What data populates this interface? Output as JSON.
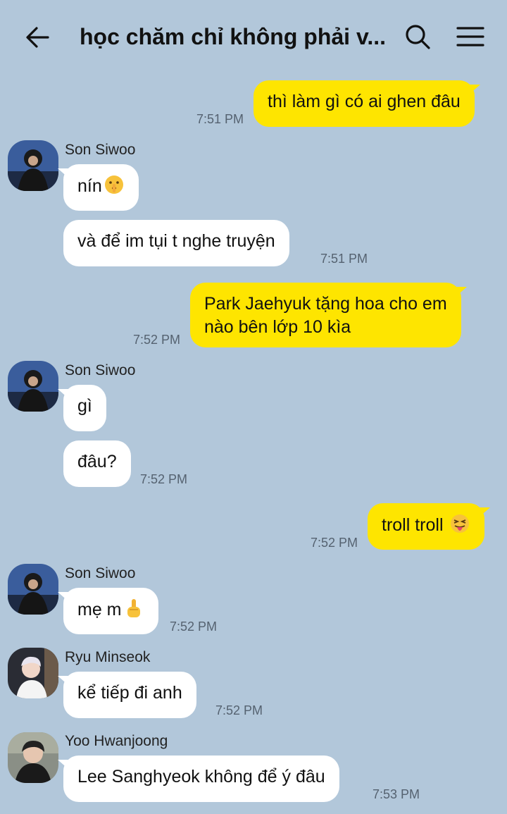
{
  "header": {
    "title": "học chăm chỉ không phải v...",
    "back_icon": "arrow-left-icon",
    "search_icon": "search-icon",
    "menu_icon": "hamburger-menu-icon"
  },
  "colors": {
    "background": "#b2c7da",
    "my_bubble": "#fee500",
    "their_bubble": "#ffffff"
  },
  "messages": [
    {
      "from": "me",
      "text": "thì làm gì có ai ghen đâu",
      "time": "7:51 PM"
    },
    {
      "from": "Son Siwoo",
      "sender": "Son Siwoo",
      "text": "nín",
      "emoji": "shushing-face-emoji"
    },
    {
      "from": "Son Siwoo",
      "text": "và để im tụi t nghe truyện",
      "time": "7:51 PM"
    },
    {
      "from": "me",
      "line1": "Park Jaehyuk tặng hoa cho em",
      "line2": "nào bên lớp 10 kìa",
      "time": "7:52 PM"
    },
    {
      "from": "Son Siwoo",
      "sender": "Son Siwoo",
      "text": "gì"
    },
    {
      "from": "Son Siwoo",
      "text": "đâu?",
      "time": "7:52 PM"
    },
    {
      "from": "me",
      "text": "troll troll",
      "emoji": "tongue-out-face-emoji",
      "time": "7:52 PM"
    },
    {
      "from": "Son Siwoo",
      "sender": "Son Siwoo",
      "text": "mẹ m",
      "emoji": "middle-finger-emoji",
      "time": "7:52 PM"
    },
    {
      "from": "Ryu Minseok",
      "sender": "Ryu Minseok",
      "text": "kể tiếp đi anh",
      "time": "7:52 PM"
    },
    {
      "from": "Yoo Hwanjoong",
      "sender": "Yoo Hwanjoong",
      "text": "Lee Sanghyeok không để ý đâu",
      "time": "7:53 PM"
    }
  ]
}
